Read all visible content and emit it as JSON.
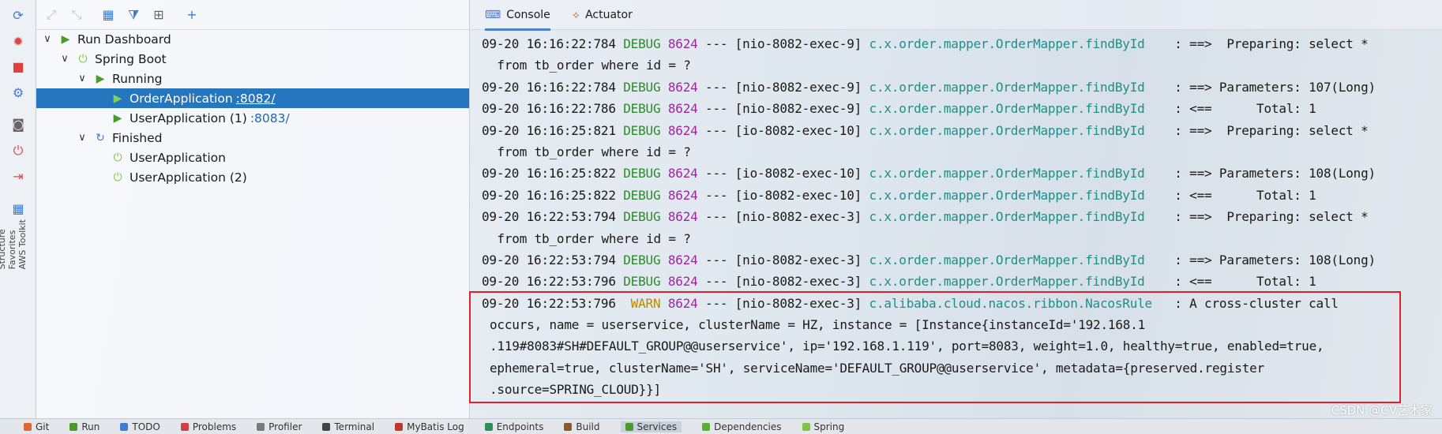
{
  "left_strip": {
    "icons": [
      "refresh-icon",
      "bug-icon",
      "stop-icon",
      "settings-icon",
      "camera-icon",
      "plug-icon",
      "exit-icon",
      "layout-icon"
    ],
    "vertical_labels": [
      "Structure",
      "Favorites",
      "AWS Toolkit"
    ]
  },
  "dashboard": {
    "toolbar_icons": [
      "refresh-icon",
      "expand-all-icon",
      "collapse-all-icon",
      "group-icon",
      "filter-icon",
      "new-window-icon",
      "add-icon"
    ],
    "tree": {
      "root": "Run Dashboard",
      "spring_boot": "Spring Boot",
      "running": "Running",
      "running_items": [
        {
          "name": "OrderApplication",
          "port": ":8082/",
          "selected": true
        },
        {
          "name": "UserApplication (1)",
          "port": ":8083/",
          "selected": false
        }
      ],
      "finished": "Finished",
      "finished_items": [
        "UserApplication",
        "UserApplication (2)"
      ]
    }
  },
  "console": {
    "tabs": [
      {
        "label": "Console",
        "active": true
      },
      {
        "label": "Actuator",
        "active": false
      }
    ],
    "lines": [
      {
        "ts": "09-20 16:16:22:784",
        "level": "DEBUG",
        "pid": "8624",
        "thread": " --- [nio-8082-exec-9] ",
        "logger": "c.x.order.mapper.OrderMapper.findById",
        "msg": "    : ==>  Preparing: select *"
      },
      {
        "cont": " from tb_order where id = ?"
      },
      {
        "ts": "09-20 16:16:22:784",
        "level": "DEBUG",
        "pid": "8624",
        "thread": " --- [nio-8082-exec-9] ",
        "logger": "c.x.order.mapper.OrderMapper.findById",
        "msg": "    : ==> Parameters: 107(Long)"
      },
      {
        "ts": "09-20 16:16:22:786",
        "level": "DEBUG",
        "pid": "8624",
        "thread": " --- [nio-8082-exec-9] ",
        "logger": "c.x.order.mapper.OrderMapper.findById",
        "msg": "    : <==      Total: 1"
      },
      {
        "ts": "09-20 16:16:25:821",
        "level": "DEBUG",
        "pid": "8624",
        "thread": " --- [io-8082-exec-10] ",
        "logger": "c.x.order.mapper.OrderMapper.findById",
        "msg": "    : ==>  Preparing: select *"
      },
      {
        "cont": " from tb_order where id = ?"
      },
      {
        "ts": "09-20 16:16:25:822",
        "level": "DEBUG",
        "pid": "8624",
        "thread": " --- [io-8082-exec-10] ",
        "logger": "c.x.order.mapper.OrderMapper.findById",
        "msg": "    : ==> Parameters: 108(Long)"
      },
      {
        "ts": "09-20 16:16:25:822",
        "level": "DEBUG",
        "pid": "8624",
        "thread": " --- [io-8082-exec-10] ",
        "logger": "c.x.order.mapper.OrderMapper.findById",
        "msg": "    : <==      Total: 1"
      },
      {
        "ts": "09-20 16:22:53:794",
        "level": "DEBUG",
        "pid": "8624",
        "thread": " --- [nio-8082-exec-3] ",
        "logger": "c.x.order.mapper.OrderMapper.findById",
        "msg": "    : ==>  Preparing: select *"
      },
      {
        "cont": " from tb_order where id = ?"
      },
      {
        "ts": "09-20 16:22:53:794",
        "level": "DEBUG",
        "pid": "8624",
        "thread": " --- [nio-8082-exec-3] ",
        "logger": "c.x.order.mapper.OrderMapper.findById",
        "msg": "    : ==> Parameters: 108(Long)"
      },
      {
        "ts": "09-20 16:22:53:796",
        "level": "DEBUG",
        "pid": "8624",
        "thread": " --- [nio-8082-exec-3] ",
        "logger": "c.x.order.mapper.OrderMapper.findById",
        "msg": "    : <==      Total: 1"
      },
      {
        "ts": "09-20 16:22:53:796",
        "level": " WARN",
        "pid": "8624",
        "thread": " --- [nio-8082-exec-3] ",
        "logger": "c.alibaba.cloud.nacos.ribbon.NacosRule",
        "msg": "   : A cross-cluster call"
      },
      {
        "cont": "occurs, name = userservice, clusterName = HZ, instance = [Instance{instanceId='192.168.1"
      },
      {
        "cont": ".119#8083#SH#DEFAULT_GROUP@@userservice', ip='192.168.1.119', port=8083, weight=1.0, healthy=true, enabled=true,"
      },
      {
        "cont": "ephemeral=true, clusterName='SH', serviceName='DEFAULT_GROUP@@userservice', metadata={preserved.register"
      },
      {
        "cont": ".source=SPRING_CLOUD}}]"
      }
    ]
  },
  "bottom_bar": {
    "items": [
      {
        "label": "Git",
        "color": "#e0662f"
      },
      {
        "label": "Run",
        "color": "#4c9a2a"
      },
      {
        "label": "TODO",
        "color": "#3d7bd8"
      },
      {
        "label": "Problems",
        "color": "#d34040"
      },
      {
        "label": "Profiler",
        "color": "#7a7a7a"
      },
      {
        "label": "Terminal",
        "color": "#444444"
      },
      {
        "label": "MyBatis Log",
        "color": "#c0392b"
      },
      {
        "label": "Endpoints",
        "color": "#2f8f5b"
      },
      {
        "label": "Build",
        "color": "#8a5a2b"
      },
      {
        "label": "Services",
        "color": "#4c9a2a",
        "active": true
      },
      {
        "label": "Dependencies",
        "color": "#5aaf33"
      },
      {
        "label": "Spring",
        "color": "#7fc447"
      }
    ]
  },
  "watermark": "CSDN @CV艺术家",
  "colors": {
    "selection": "#2675bf",
    "debug": "#2c8a2c",
    "warn": "#b58c00",
    "pid": "#a0269f",
    "logger": "#1f8f86",
    "highlight_box": "#e0202a"
  }
}
